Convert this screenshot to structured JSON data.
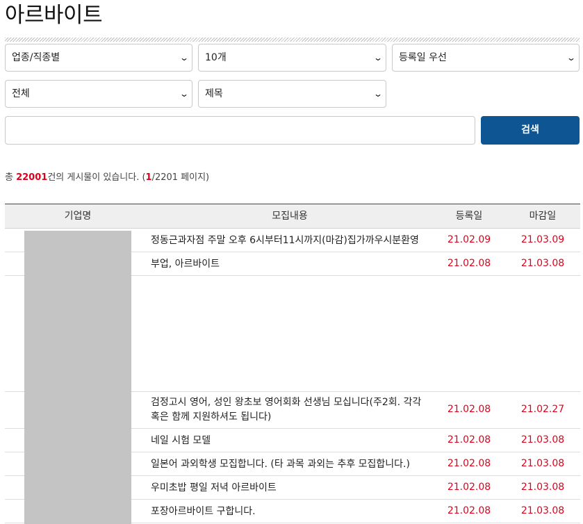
{
  "page_title": "아르바이트",
  "filters": {
    "category": "업종/직종별",
    "count": "10개",
    "sort": "등록일 우선",
    "region": "전체",
    "field": "제목",
    "chevron_icon": "chevron-down-icon"
  },
  "search": {
    "value": "",
    "button_label": "검색"
  },
  "summary": {
    "prefix": "총 ",
    "total": "22001",
    "middle": "건의 게시물이 있습니다. (",
    "current_page": "1",
    "suffix": "/2201 페이지)"
  },
  "table": {
    "headers": {
      "company": "기업명",
      "content": "모집내용",
      "registered": "등록일",
      "deadline": "마감일"
    },
    "rows": [
      {
        "title": "정동근과자점 주말 오후 6시부터11시까지(마감)집가까우시분환영",
        "registered": "21.02.09",
        "deadline": "21.03.09"
      },
      {
        "title": "부업, 아르바이트",
        "registered": "21.02.08",
        "deadline": "21.03.08"
      },
      {
        "title": "",
        "registered": "",
        "deadline": ""
      },
      {
        "title": "검정고시 영어, 성인 왕초보 영어회화 선생님 모십니다(주2회. 각각 혹은 함께 지원하셔도 됩니다)",
        "registered": "21.02.08",
        "deadline": "21.02.27"
      },
      {
        "title": "네일 시험 모델",
        "registered": "21.02.08",
        "deadline": "21.03.08"
      },
      {
        "title": "일본어 과외학생 모집합니다. (타 과목 과외는 추후 모집합니다.)",
        "registered": "21.02.08",
        "deadline": "21.03.08"
      },
      {
        "title": "우미초밥 평일 저녁 아르바이트",
        "registered": "21.02.08",
        "deadline": "21.03.08"
      },
      {
        "title": "포장아르바이트 구합니다.",
        "registered": "21.02.08",
        "deadline": "21.03.08"
      }
    ]
  },
  "colors": {
    "accent": "#0d5593",
    "date_red": "#e0001b"
  }
}
